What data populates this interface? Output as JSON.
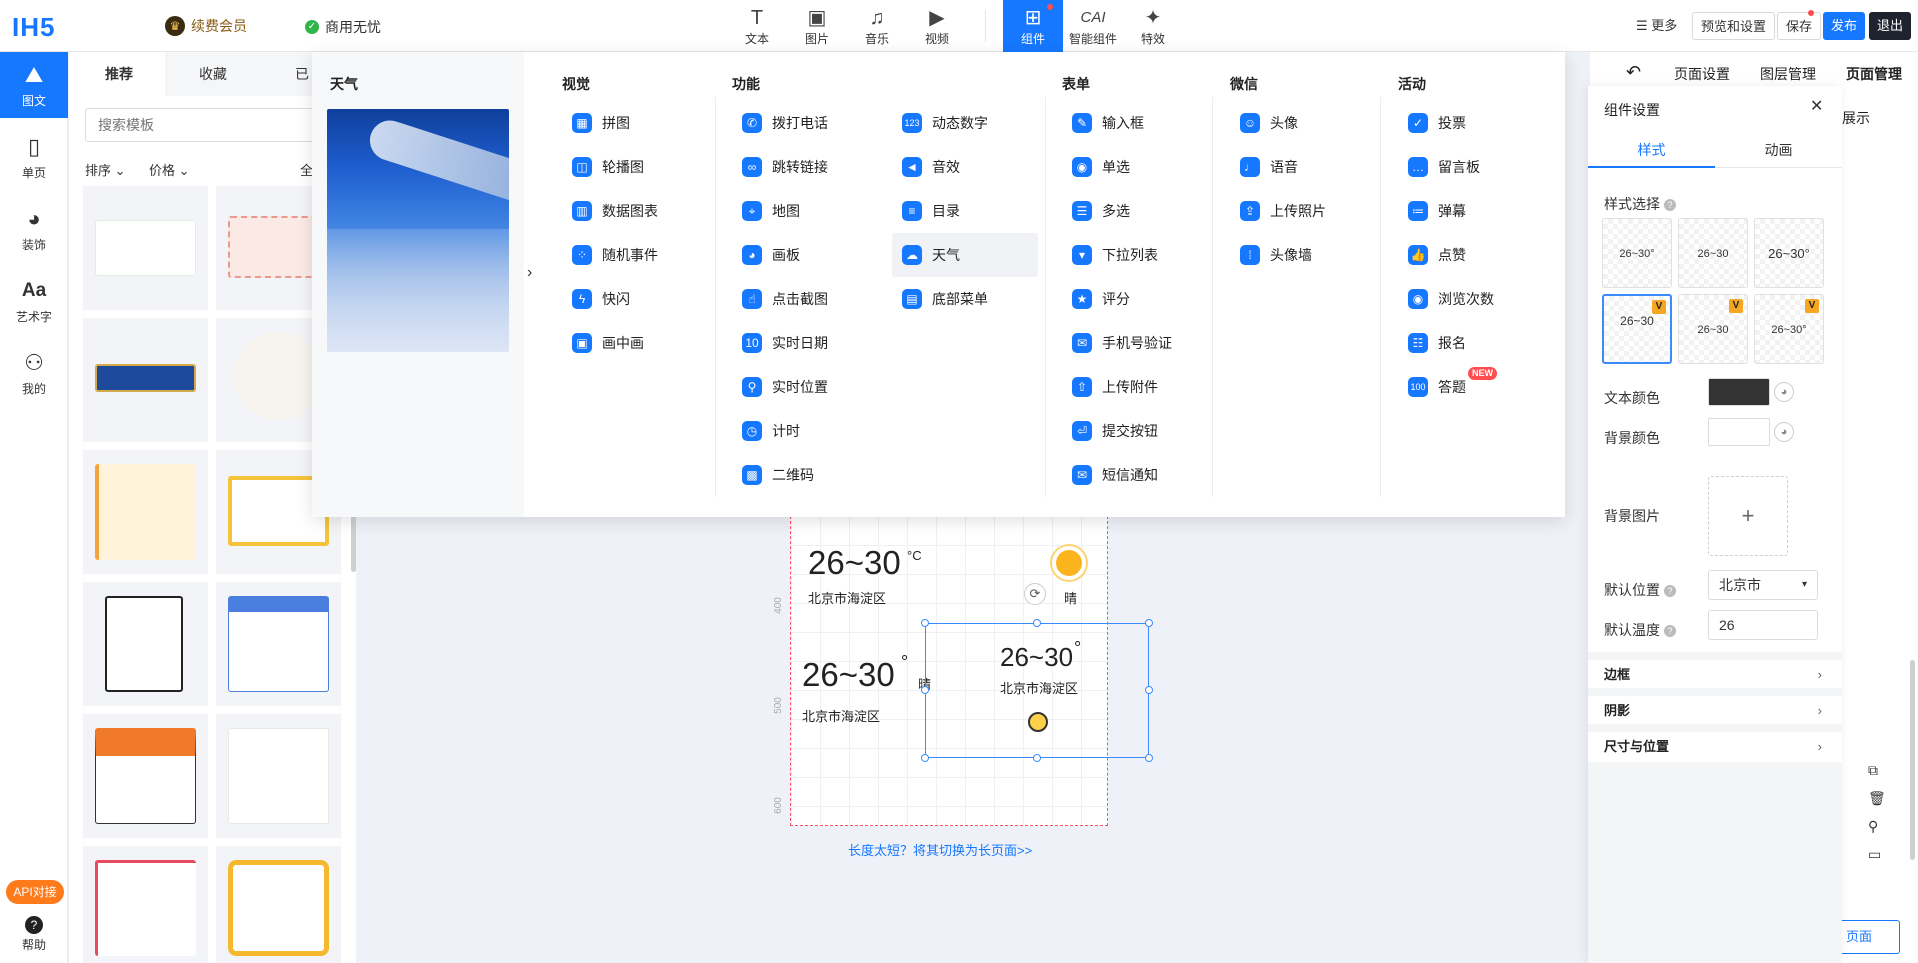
{
  "topbar": {
    "logo": "IH5",
    "vip_label": "续费会员",
    "commercial_label": "商用无忧",
    "tools": [
      "文本",
      "图片",
      "音乐",
      "视频",
      "组件",
      "智能组件",
      "特效"
    ],
    "tool_icons": [
      "text-icon",
      "image-icon",
      "music-icon",
      "video-icon",
      "component-icon",
      "ai-component-icon",
      "effects-icon"
    ],
    "more": "更多",
    "preview": "预览和设置",
    "save": "保存",
    "publish": "发布",
    "exit": "退出",
    "accent": "#1677ff"
  },
  "leftnav": {
    "items": [
      "图文",
      "单页",
      "装饰",
      "艺术字",
      "我的"
    ],
    "icons": [
      "graphic-text-icon",
      "single-page-icon",
      "palette-icon",
      "font-icon",
      "user-icon"
    ],
    "api": "API对接",
    "help": "帮助"
  },
  "templates": {
    "tabs": [
      "推荐",
      "收藏",
      "已"
    ],
    "search_placeholder": "搜索模板",
    "sort": "排序",
    "price": "价格",
    "all": "全"
  },
  "component_panel": {
    "preview_title": "天气",
    "columns": [
      {
        "title": "视觉",
        "items": [
          "拼图",
          "轮播图",
          "数据图表",
          "随机事件",
          "快闪",
          "画中画"
        ]
      },
      {
        "title": "功能",
        "items": [
          "拨打电话",
          "跳转链接",
          "地图",
          "画板",
          "点击截图",
          "实时日期",
          "实时位置",
          "计时",
          "二维码"
        ]
      },
      {
        "title": "",
        "items": [
          "动态数字",
          "音效",
          "目录",
          "天气",
          "底部菜单"
        ]
      },
      {
        "title": "表单",
        "items": [
          "输入框",
          "单选",
          "多选",
          "下拉列表",
          "评分",
          "手机号验证",
          "上传附件",
          "提交按钮",
          "短信通知"
        ]
      },
      {
        "title": "微信",
        "items": [
          "头像",
          "语音",
          "上传照片",
          "头像墙"
        ]
      },
      {
        "title": "活动",
        "items": [
          "投票",
          "留言板",
          "弹幕",
          "点赞",
          "浏览次数",
          "报名",
          "答题"
        ]
      }
    ],
    "new_badge": "NEW"
  },
  "canvas": {
    "widget1_temp": "26~30",
    "widget1_unit": "°C",
    "widget1_loc": "北京市海淀区",
    "widget1_cond": "晴",
    "widget2_temp": "26~30",
    "widget2_unit": "°",
    "widget2_loc": "北京市海淀区",
    "widget2_cond": "晴",
    "widget3_temp": "26~30",
    "widget3_unit": "°",
    "widget3_loc": "北京市海淀区",
    "ruler": [
      "400",
      "500",
      "600"
    ],
    "switch_link": "长度太短？将其切换为长页面>>"
  },
  "right_tabs": {
    "page_settings": "页面设置",
    "layer_mgmt": "图层管理",
    "page_mgmt": "页面管理",
    "show": "展示",
    "add_page": "页面"
  },
  "settings": {
    "title": "组件设置",
    "tabs": [
      "样式",
      "动画"
    ],
    "style_select": "样式选择",
    "style_cells": [
      "26~30°",
      "26~30",
      "26~30°",
      "26~30",
      "26~30",
      "26~30°"
    ],
    "text_color_label": "文本颜色",
    "text_color": "#333333",
    "bg_color_label": "背景颜色",
    "bg_image_label": "背景图片",
    "default_location_label": "默认位置",
    "default_location": "北京市",
    "default_temp_label": "默认温度",
    "default_temp": "26",
    "sections": [
      "边框",
      "阴影",
      "尺寸与位置"
    ]
  }
}
